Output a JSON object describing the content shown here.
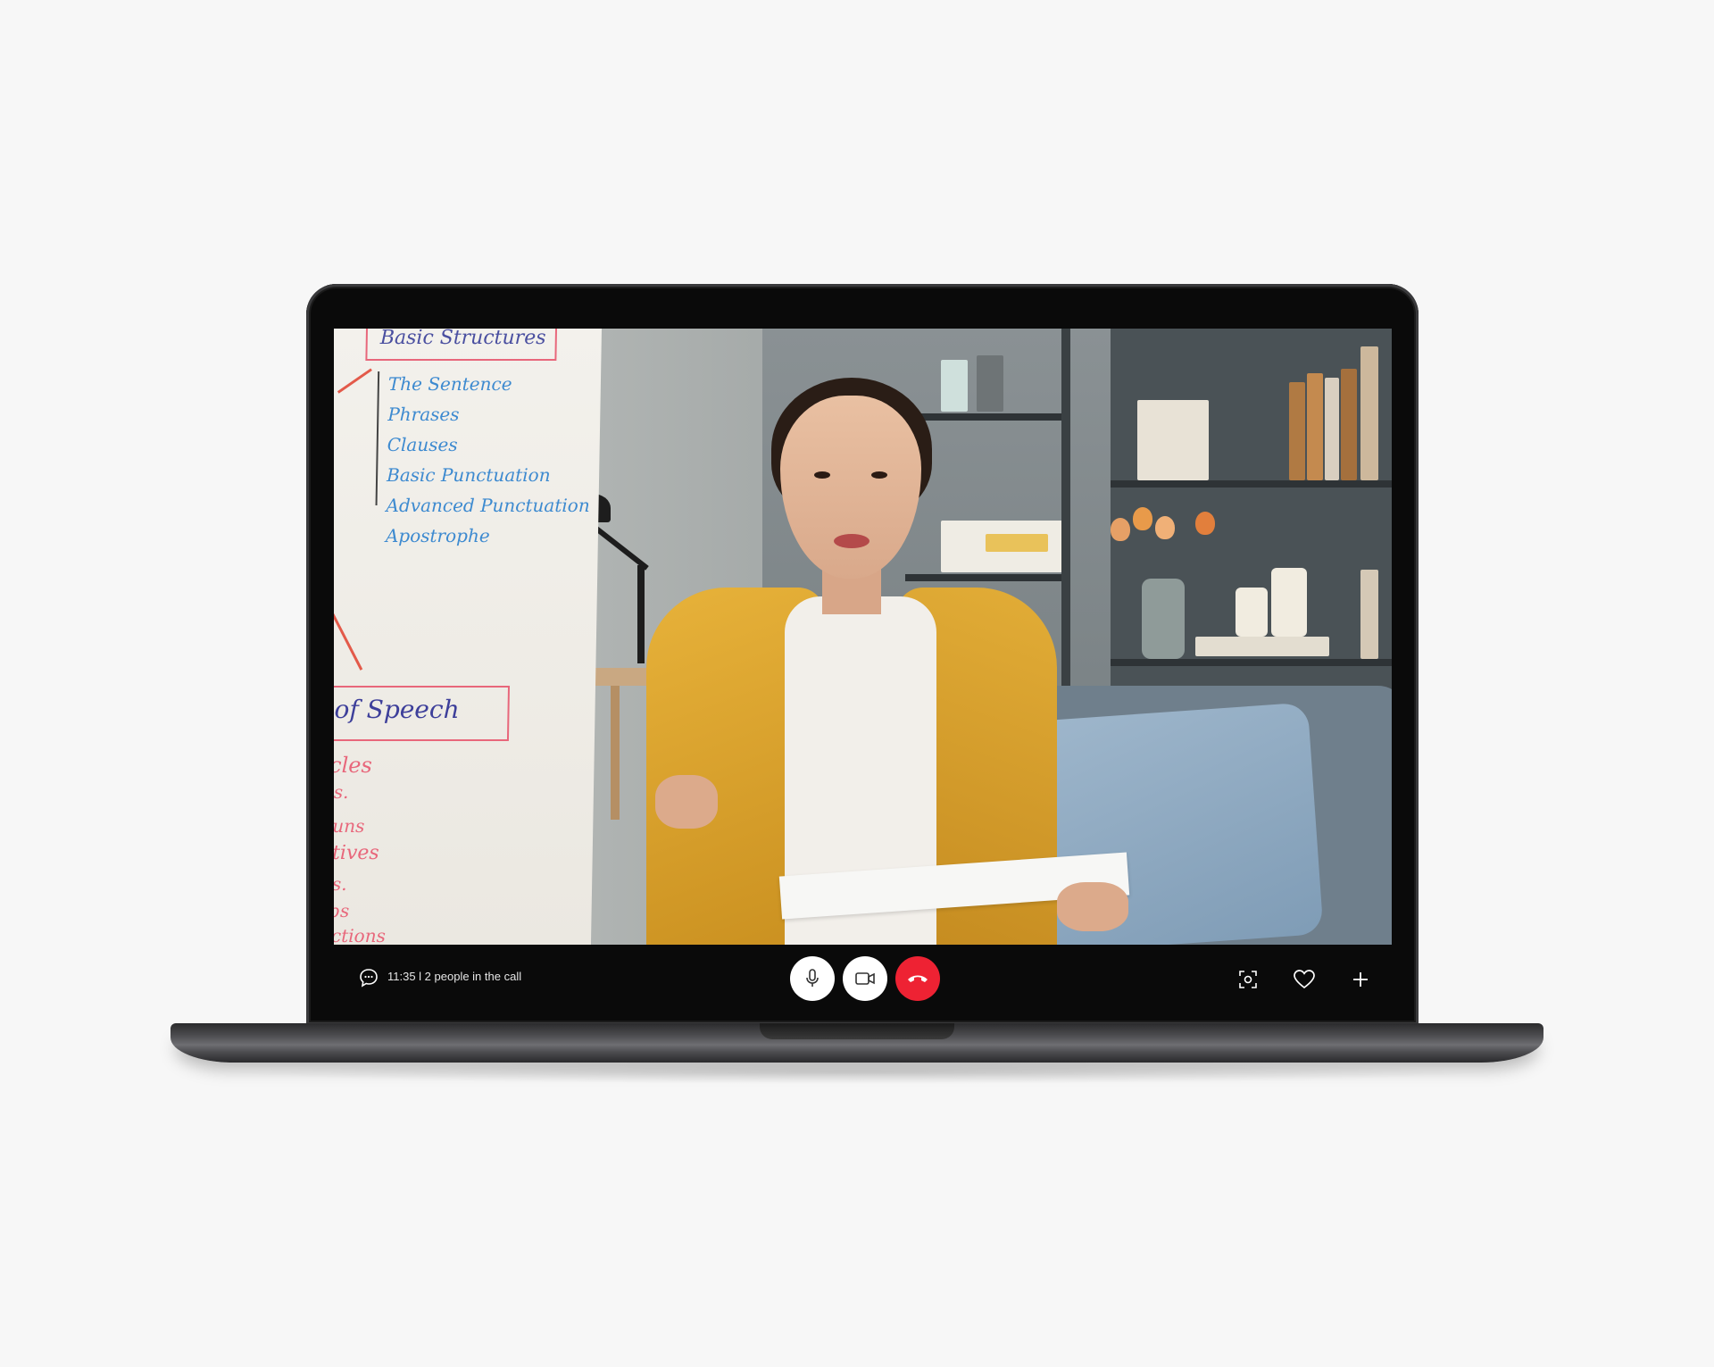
{
  "call": {
    "status_text": "11:35 l 2 people in the call"
  },
  "controls": {
    "mic_icon": "microphone-icon",
    "camera_icon": "video-camera-icon",
    "hangup_icon": "phone-hangup-icon",
    "hangup_color": "#ee2233"
  },
  "actions": {
    "chat_icon": "chat-bubble-icon",
    "screenshot_icon": "screen-capture-icon",
    "favorite_icon": "heart-icon",
    "add_icon": "plus-icon"
  },
  "whiteboard": {
    "heading": "Basic Structures",
    "items": [
      "The Sentence",
      "Phrases",
      "Clauses",
      "Basic Punctuation",
      "Advanced Punctuation",
      "Apostrophe"
    ],
    "section2": "of Speech",
    "section2_items": [
      "icles",
      "ns.",
      "ouns",
      "ctives",
      "bs.",
      "rbs",
      "nctions"
    ]
  }
}
